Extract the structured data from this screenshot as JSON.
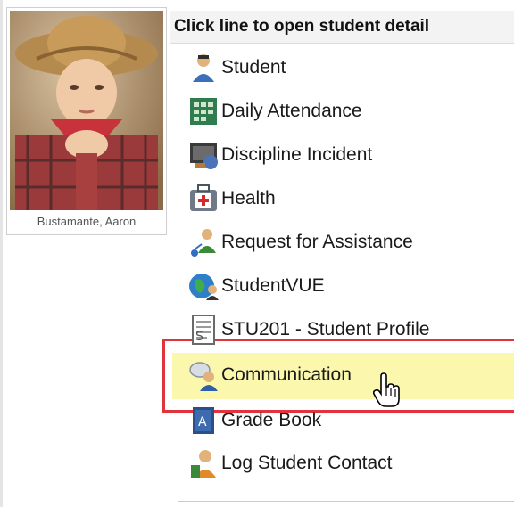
{
  "student": {
    "name": "Bustamante, Aaron"
  },
  "panel": {
    "header": "Click line to open student detail"
  },
  "menu": {
    "items": [
      {
        "label": "Student",
        "icon": "student-icon"
      },
      {
        "label": "Daily Attendance",
        "icon": "attendance-calendar-icon"
      },
      {
        "label": "Discipline Incident",
        "icon": "discipline-icon"
      },
      {
        "label": "Health",
        "icon": "first-aid-kit-icon"
      },
      {
        "label": "Request for Assistance",
        "icon": "assistance-icon"
      },
      {
        "label": "StudentVUE",
        "icon": "globe-student-icon"
      },
      {
        "label": "STU201 - Student Profile",
        "icon": "report-document-icon"
      },
      {
        "label": "Communication",
        "icon": "communication-icon"
      },
      {
        "label": "Grade Book",
        "icon": "gradebook-icon"
      },
      {
        "label": "Log Student Contact",
        "icon": "contact-log-icon"
      }
    ],
    "highlighted_index": 7
  },
  "colors": {
    "highlight": "#fbf7ad",
    "callout_border": "#e0333b"
  }
}
